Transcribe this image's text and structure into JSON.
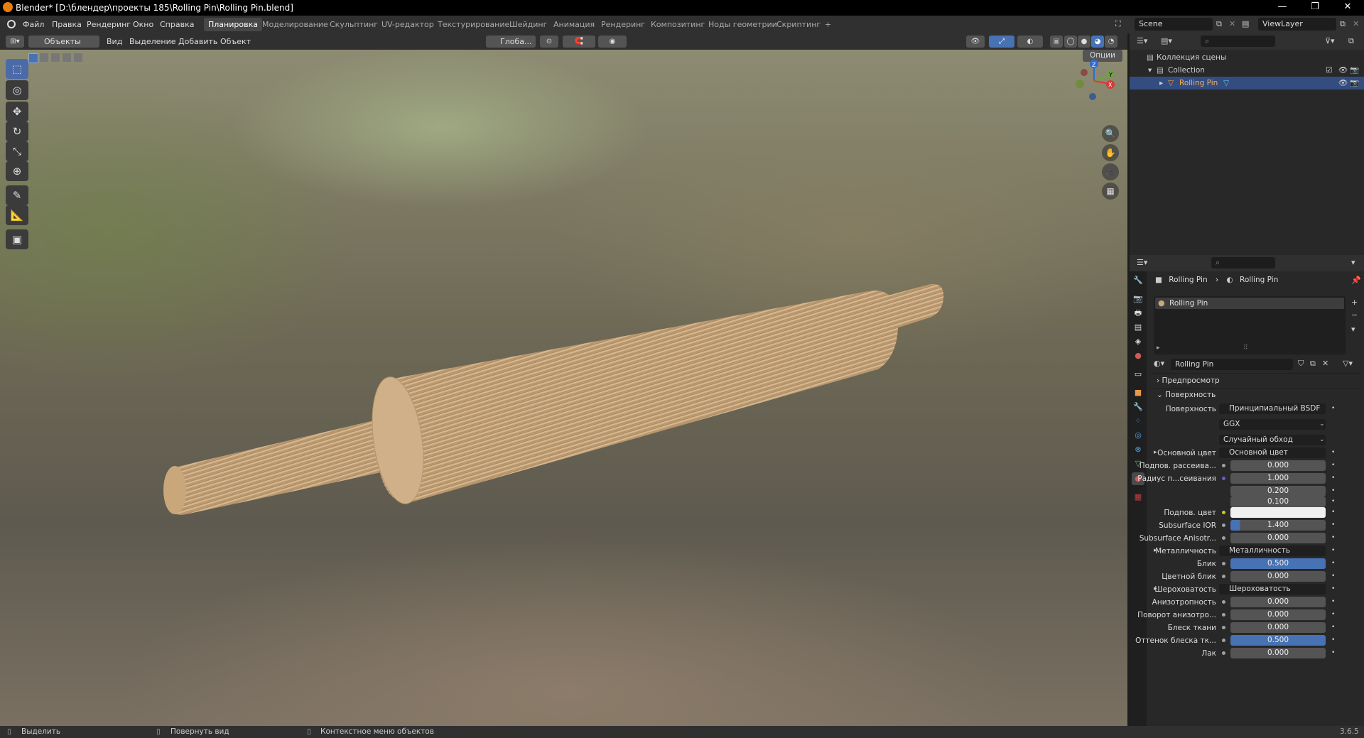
{
  "window": {
    "title": "Blender* [D:\\блендер\\проекты 185\\Rolling Pin\\Rolling Pin.blend]",
    "minimize": "—",
    "restore": "❐",
    "close": "✕"
  },
  "menu": [
    "Файл",
    "Правка",
    "Рендеринг",
    "Окно",
    "Справка"
  ],
  "workspaces": [
    "Планировка",
    "Моделирование",
    "Скульптинг",
    "UV-редактор",
    "Текстурирование",
    "Шейдинг",
    "Анимация",
    "Рендеринг",
    "Композитинг",
    "Ноды геометрии",
    "Скриптинг",
    "+"
  ],
  "scene": "Scene",
  "view_layer": "ViewLayer",
  "viewport_header": {
    "mode": "Объекты",
    "view": "Вид",
    "select": "Выделение",
    "add": "Добавить",
    "object": "Объект",
    "orientation": "Глоба...",
    "options": "Опции"
  },
  "gizmo": {
    "x": "X",
    "y": "Y",
    "z": "Z"
  },
  "outliner": {
    "root": "Коллекция сцены",
    "collection": "Collection",
    "object": "Rolling Pin"
  },
  "properties": {
    "breadcrumb_object": "Rolling Pin",
    "breadcrumb_material": "Rolling Pin",
    "slot": "Rolling Pin",
    "material_name": "Rolling Pin",
    "preview": "Предпросмотр",
    "surface_panel": "Поверхность",
    "rows": [
      {
        "label": "Поверхность",
        "value": "Принципиальный BSDF",
        "kind": "link",
        "dot": "#63c763"
      },
      {
        "label": "",
        "value": "GGX",
        "kind": "dropdown"
      },
      {
        "label": "",
        "value": "Случайный обход",
        "kind": "dropdown"
      },
      {
        "label": "Основной цвет",
        "value": "Основной цвет",
        "kind": "link",
        "dot": "#c7c729",
        "expand": true
      },
      {
        "label": "Подпов. рассеива...",
        "value": "0.000",
        "kind": "num",
        "dot": "#a1a1a1"
      },
      {
        "label": "Радиус п...сеивания",
        "value": "1.000",
        "kind": "num",
        "dot": "#6363c7"
      },
      {
        "label": "",
        "value": "0.200",
        "kind": "num"
      },
      {
        "label": "",
        "value": "0.100",
        "kind": "num"
      },
      {
        "label": "Подпов. цвет",
        "value": "",
        "kind": "color",
        "dot": "#c7c729"
      },
      {
        "label": "Subsurface IOR",
        "value": "1.400",
        "kind": "num",
        "dot": "#a1a1a1",
        "fill": 0.1
      },
      {
        "label": "Subsurface Anisotr...",
        "value": "0.000",
        "kind": "num",
        "dot": "#a1a1a1"
      },
      {
        "label": "Металличность",
        "value": "Металличность",
        "kind": "link",
        "dot": "#a1a1a1",
        "expand": true
      },
      {
        "label": "Блик",
        "value": "0.500",
        "kind": "num",
        "dot": "#a1a1a1",
        "fill": 0.5
      },
      {
        "label": "Цветной блик",
        "value": "0.000",
        "kind": "num",
        "dot": "#a1a1a1"
      },
      {
        "label": "Шероховатость",
        "value": "Шероховатость",
        "kind": "link",
        "dot": "#a1a1a1",
        "expand": true
      },
      {
        "label": "Анизотропность",
        "value": "0.000",
        "kind": "num",
        "dot": "#a1a1a1"
      },
      {
        "label": "Поворот анизотро...",
        "value": "0.000",
        "kind": "num",
        "dot": "#a1a1a1"
      },
      {
        "label": "Блеск ткани",
        "value": "0.000",
        "kind": "num",
        "dot": "#a1a1a1"
      },
      {
        "label": "Оттенок блеска тк...",
        "value": "0.500",
        "kind": "num",
        "dot": "#a1a1a1",
        "fill": 0.5
      },
      {
        "label": "Лак",
        "value": "0.000",
        "kind": "num",
        "dot": "#a1a1a1"
      }
    ]
  },
  "status": {
    "select": "Выделить",
    "rotate": "Повернуть вид",
    "context": "Контекстное меню объектов",
    "version": "3.6.5"
  }
}
